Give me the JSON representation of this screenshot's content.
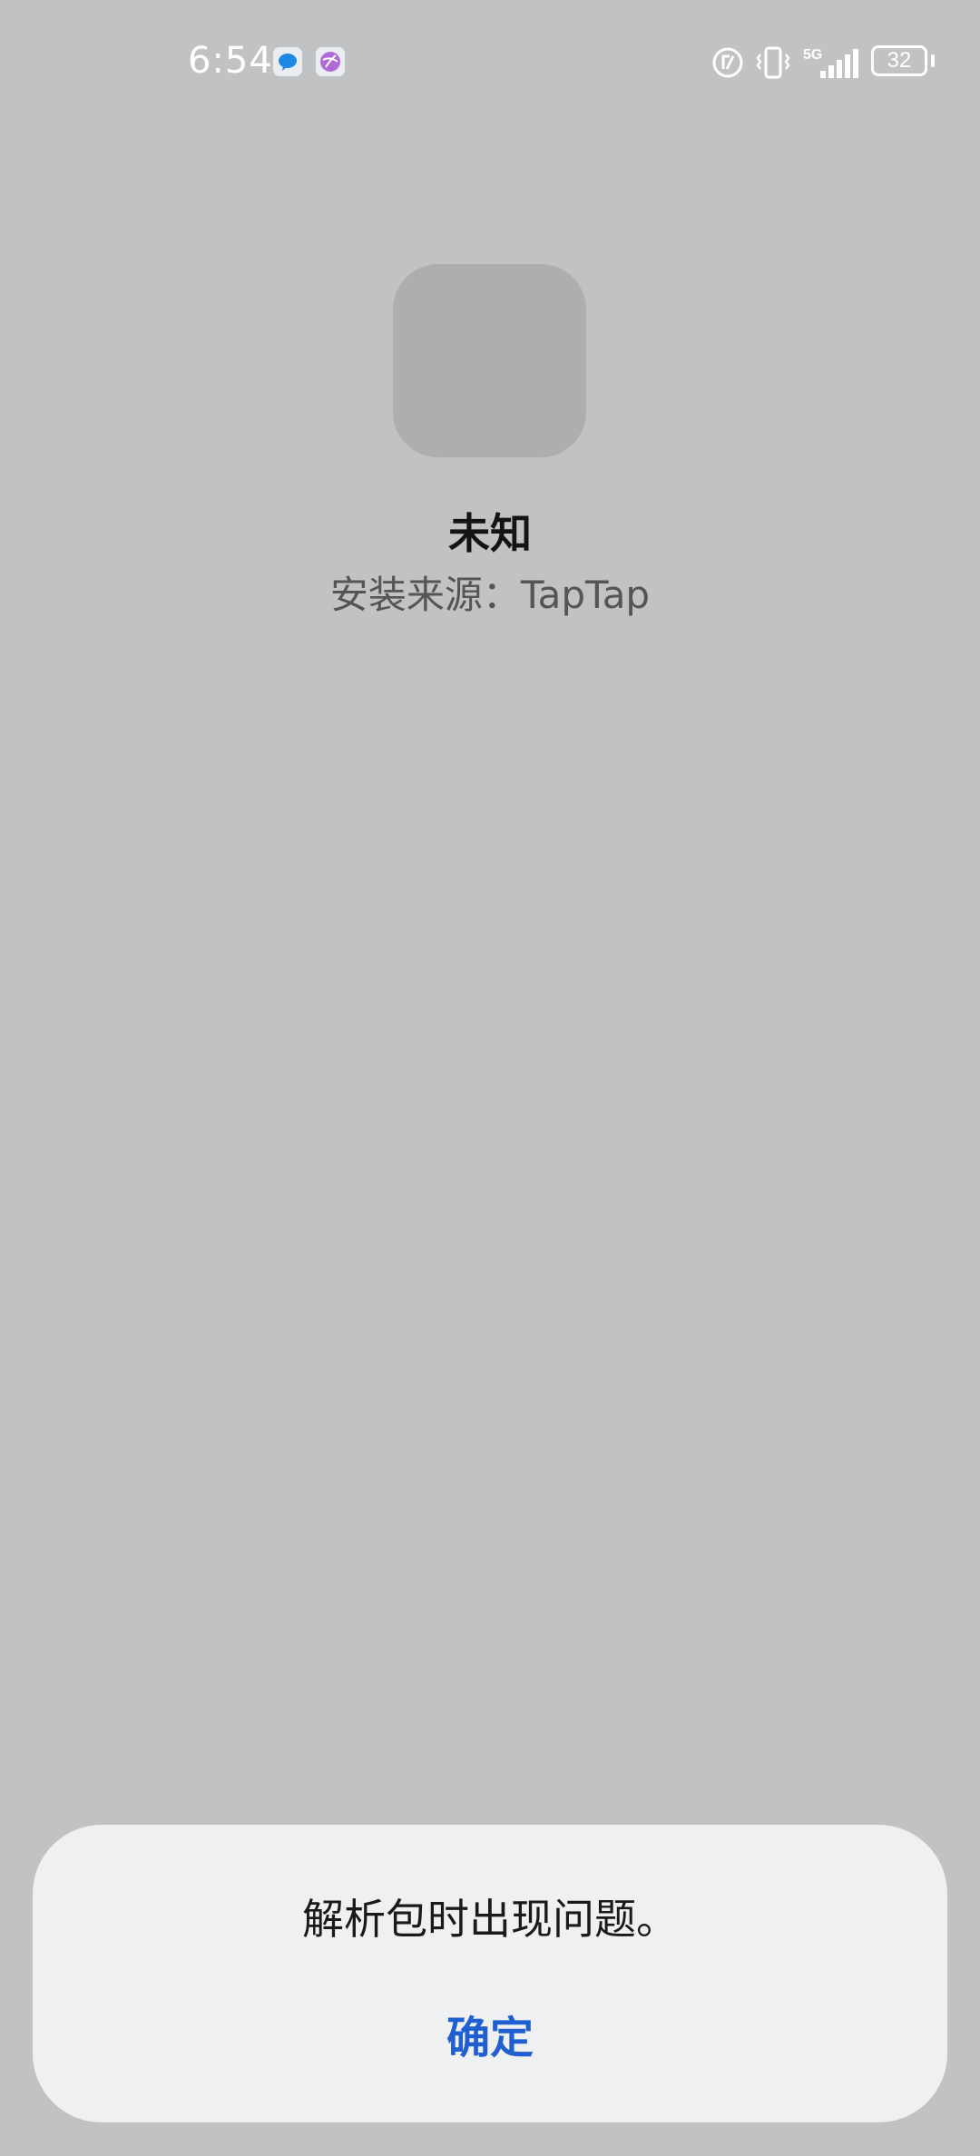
{
  "status_bar": {
    "time": "6:54",
    "notification_icons": [
      "message-icon",
      "app-notification-icon"
    ],
    "indicators": [
      "nfc-icon",
      "vibrate-icon",
      "5g-signal-icon"
    ],
    "network_label": "5G",
    "battery_level": "32"
  },
  "app": {
    "icon": "app-placeholder-icon",
    "name": "未知",
    "install_source": "安装来源：TapTap"
  },
  "dialog": {
    "message": "解析包时出现问题。",
    "confirm_label": "确定"
  },
  "colors": {
    "background": "#c1c2c4",
    "dialog_background": "#eff0f2",
    "accent": "#1f5fd0"
  }
}
